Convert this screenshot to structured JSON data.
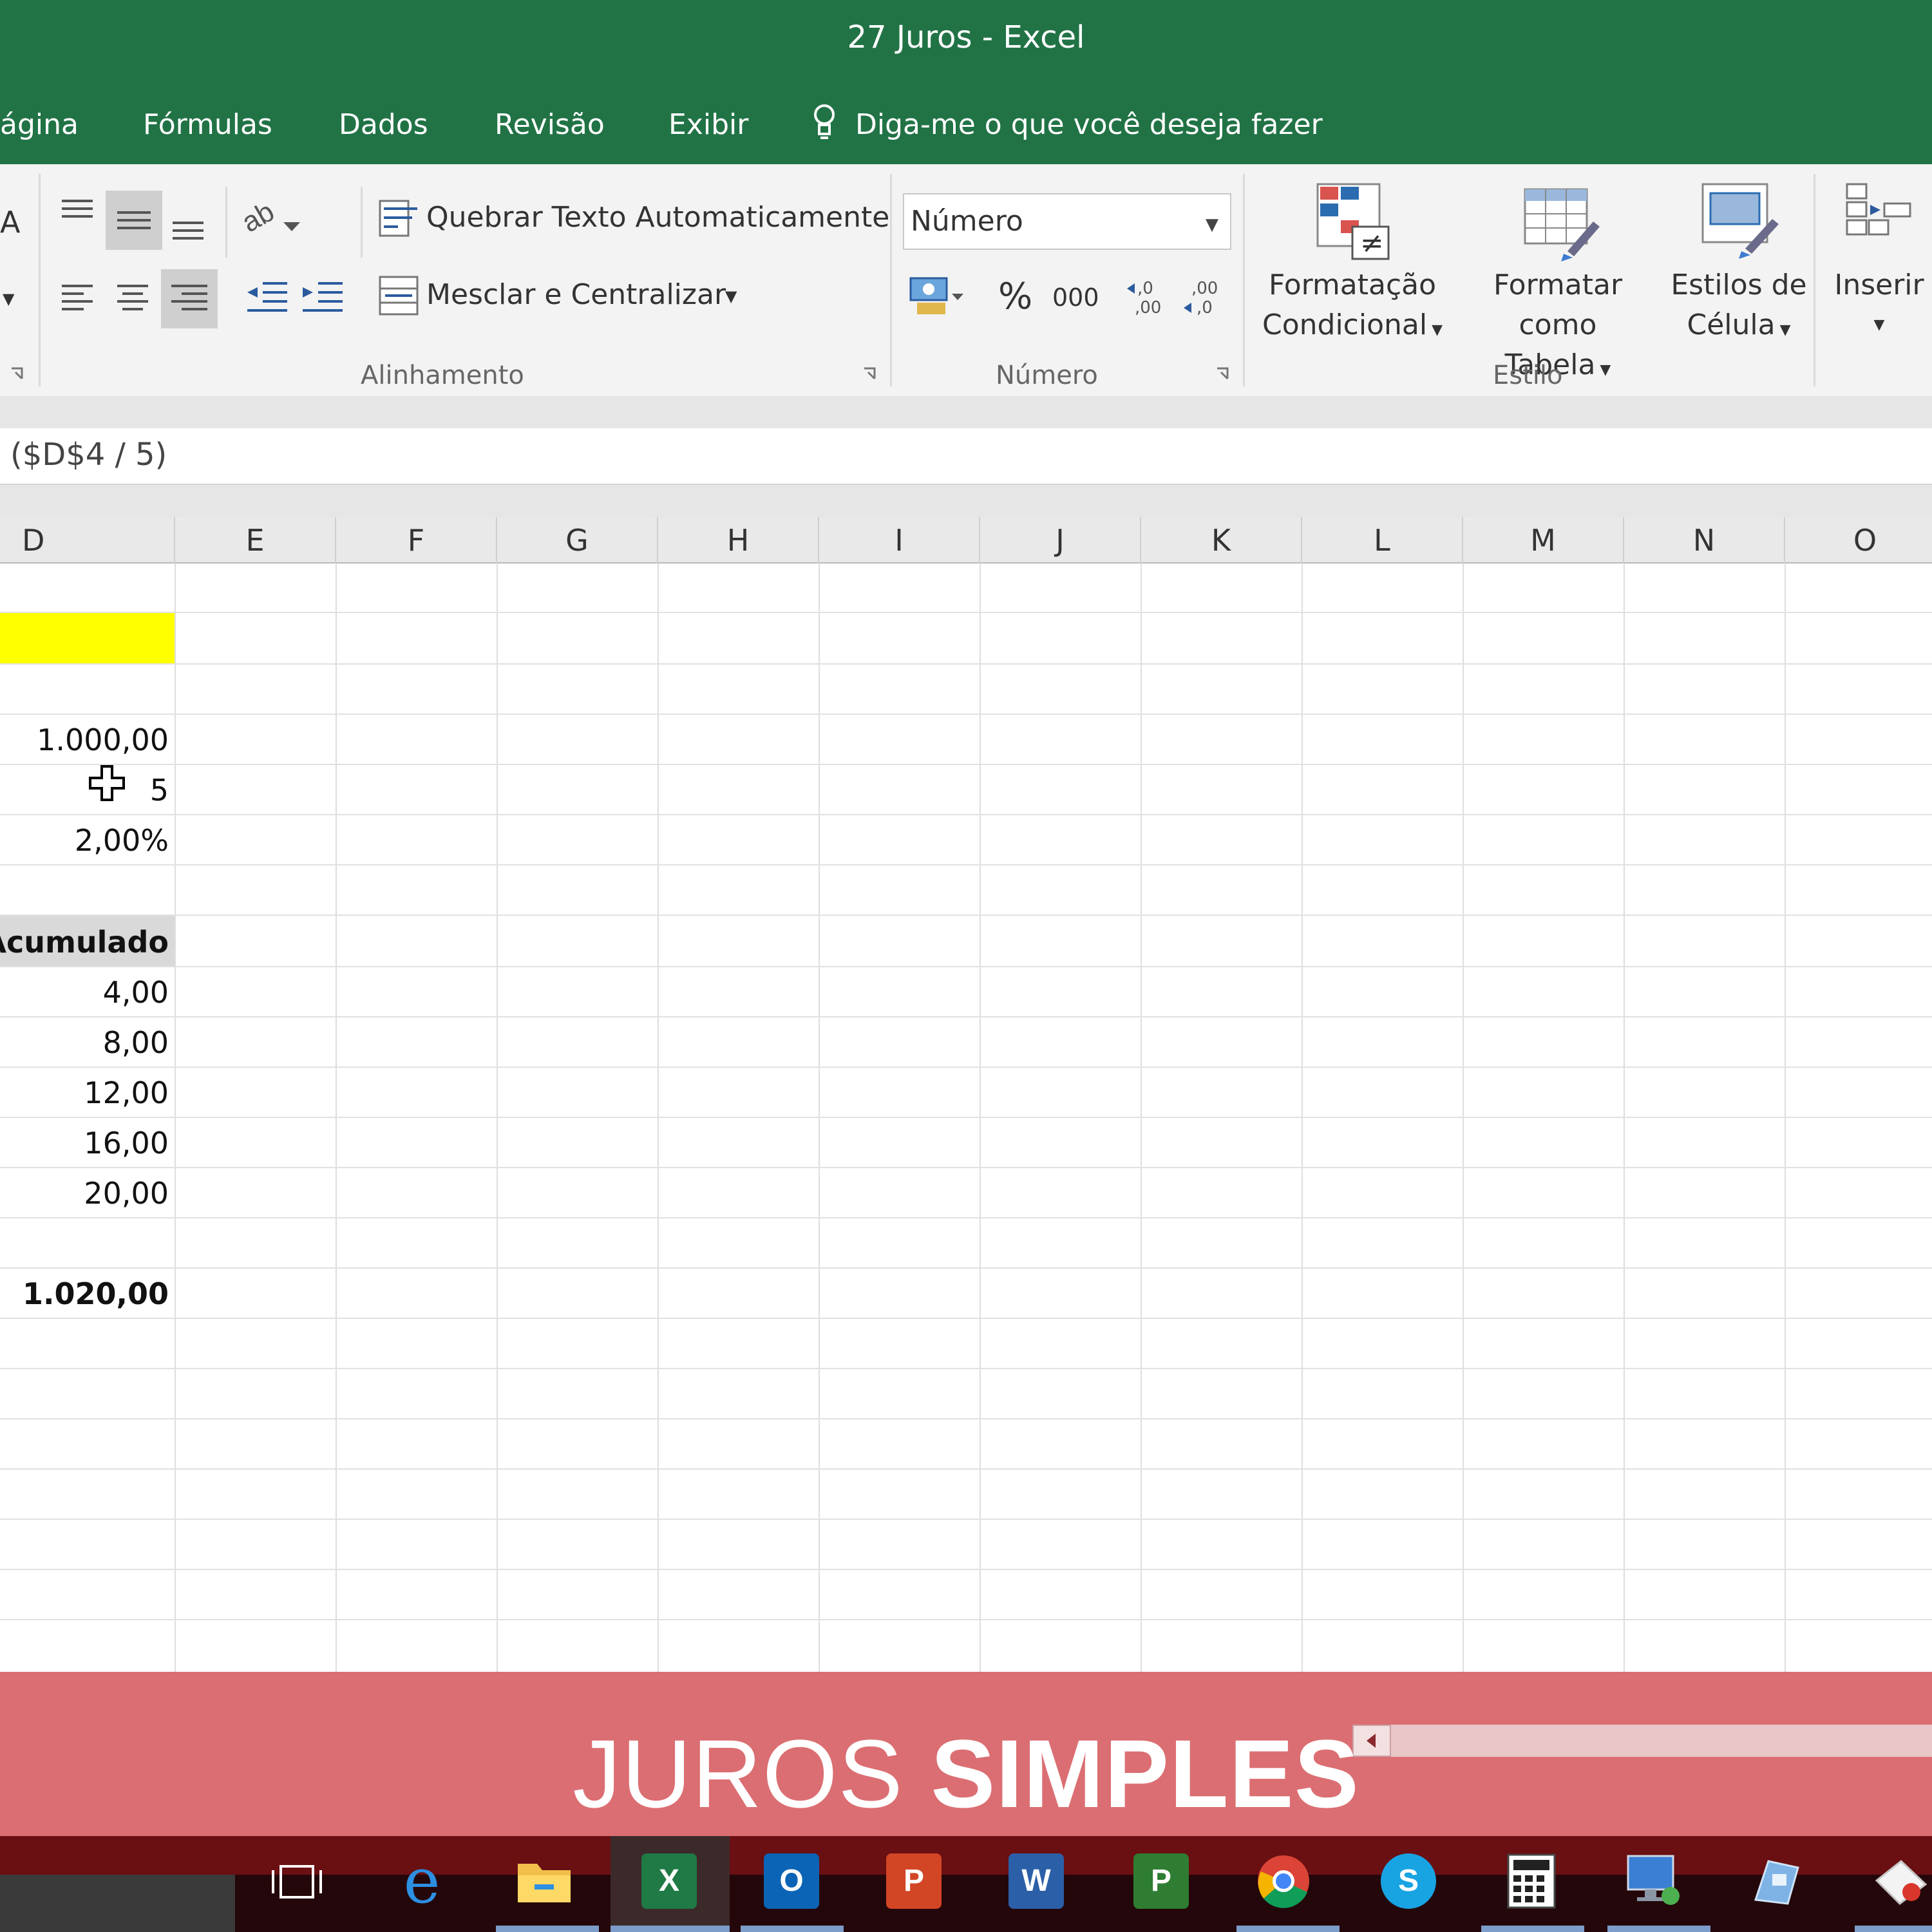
{
  "window": {
    "title": "27 Juros - Excel"
  },
  "menu": {
    "tabs": [
      "ágina",
      "Fórmulas",
      "Dados",
      "Revisão",
      "Exibir"
    ],
    "tell_me": "Diga-me o que você deseja fazer"
  },
  "ribbon": {
    "wrap_text": "Quebrar Texto Automaticamente",
    "merge_center": "Mesclar e Centralizar",
    "alignment_group": "Alinhamento",
    "number_format": "Número",
    "number_group": "Número",
    "percent": "%",
    "thousands": "000",
    "conditional_format_1": "Formatação",
    "conditional_format_2": "Condicional",
    "format_table_1": "Formatar como",
    "format_table_2": "Tabela",
    "cell_styles_1": "Estilos de",
    "cell_styles_2": "Célula",
    "styles_group": "Estilo",
    "insert": "Inserir"
  },
  "formula_bar": {
    "text": "($D$4 / 5)"
  },
  "columns": [
    "D",
    "E",
    "F",
    "G",
    "H",
    "I",
    "J",
    "K",
    "L",
    "M",
    "N",
    "O"
  ],
  "cells": {
    "d4": "1.000,00",
    "d5": "5",
    "d6": "2,00%",
    "d8": "Acumulado",
    "d9": "4,00",
    "d10": "8,00",
    "d11": "12,00",
    "d12": "16,00",
    "d13": "20,00",
    "d15": "1.020,00"
  },
  "banner": {
    "word1": "JUROS",
    "word2": "SIMPLES"
  },
  "taskbar": {
    "apps": [
      "task-view",
      "edge",
      "file-explorer",
      "excel",
      "outlook",
      "powerpoint",
      "word",
      "project",
      "chrome",
      "skype",
      "calculator",
      "remote-desktop",
      "paint",
      "snipping"
    ],
    "excel_glyph": "X",
    "outlook_glyph": "O",
    "powerpoint_glyph": "P",
    "word_glyph": "W",
    "project_glyph": "P",
    "skype_glyph": "S"
  },
  "colors": {
    "excel_green": "#217346",
    "highlight_yellow": "#FFFF00",
    "banner": "#D65A5F"
  }
}
